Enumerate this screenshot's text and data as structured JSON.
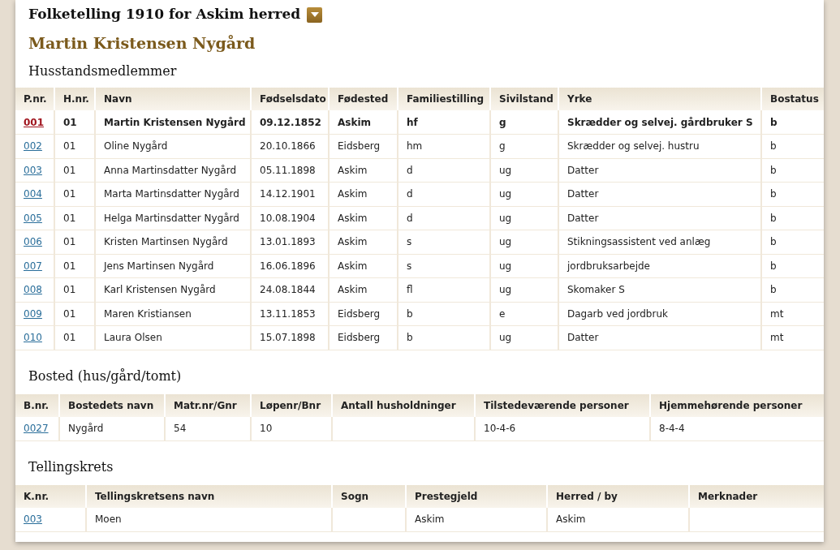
{
  "page_title": "Folketelling 1910 for Askim herred",
  "person_name": "Martin Kristensen Nygård",
  "household": {
    "heading": "Husstandsmedlemmer",
    "columns": [
      "P.nr.",
      "H.nr.",
      "Navn",
      "Fødselsdato",
      "Fødested",
      "Familiestilling",
      "Sivilstand",
      "Yrke",
      "Bostatus"
    ],
    "rows": [
      {
        "selected": true,
        "cells": [
          "001",
          "01",
          "Martin Kristensen Nygård",
          "09.12.1852",
          "Askim",
          "hf",
          "g",
          "Skrædder og selvej. gårdbruker S",
          "b"
        ]
      },
      {
        "selected": false,
        "cells": [
          "002",
          "01",
          "Oline Nygård",
          "20.10.1866",
          "Eidsberg",
          "hm",
          "g",
          "Skrædder og selvej. hustru",
          "b"
        ]
      },
      {
        "selected": false,
        "cells": [
          "003",
          "01",
          "Anna Martinsdatter Nygård",
          "05.11.1898",
          "Askim",
          "d",
          "ug",
          "Datter",
          "b"
        ]
      },
      {
        "selected": false,
        "cells": [
          "004",
          "01",
          "Marta Martinsdatter Nygård",
          "14.12.1901",
          "Askim",
          "d",
          "ug",
          "Datter",
          "b"
        ]
      },
      {
        "selected": false,
        "cells": [
          "005",
          "01",
          "Helga Martinsdatter Nygård",
          "10.08.1904",
          "Askim",
          "d",
          "ug",
          "Datter",
          "b"
        ]
      },
      {
        "selected": false,
        "cells": [
          "006",
          "01",
          "Kristen Martinsen Nygård",
          "13.01.1893",
          "Askim",
          "s",
          "ug",
          "Stikningsassistent ved anlæg",
          "b"
        ]
      },
      {
        "selected": false,
        "cells": [
          "007",
          "01",
          "Jens Martinsen Nygård",
          "16.06.1896",
          "Askim",
          "s",
          "ug",
          "jordbruksarbejde",
          "b"
        ]
      },
      {
        "selected": false,
        "cells": [
          "008",
          "01",
          "Karl Kristensen Nygård",
          "24.08.1844",
          "Askim",
          "fl",
          "ug",
          "Skomaker S",
          "b"
        ]
      },
      {
        "selected": false,
        "cells": [
          "009",
          "01",
          "Maren Kristiansen",
          "13.11.1853",
          "Eidsberg",
          "b",
          "e",
          "Dagarb ved jordbruk",
          "mt"
        ]
      },
      {
        "selected": false,
        "cells": [
          "010",
          "01",
          "Laura Olsen",
          "15.07.1898",
          "Eidsberg",
          "b",
          "ug",
          "Datter",
          "mt"
        ]
      }
    ]
  },
  "residence": {
    "heading": "Bosted (hus/gård/tomt)",
    "columns": [
      "B.nr.",
      "Bostedets navn",
      "Matr.nr/Gnr",
      "Løpenr/Bnr",
      "Antall husholdninger",
      "Tilstedeværende personer",
      "Hjemmehørende personer"
    ],
    "rows": [
      {
        "cells": [
          "0027",
          "Nygård",
          "54",
          "10",
          "",
          "10-4-6",
          "8-4-4"
        ]
      }
    ]
  },
  "district": {
    "heading": "Tellingskrets",
    "columns": [
      "K.nr.",
      "Tellingskretsens navn",
      "Sogn",
      "Prestegjeld",
      "Herred / by",
      "Merknader"
    ],
    "rows": [
      {
        "cells": [
          "003",
          "Moen",
          "",
          "Askim",
          "Askim",
          ""
        ]
      }
    ]
  }
}
